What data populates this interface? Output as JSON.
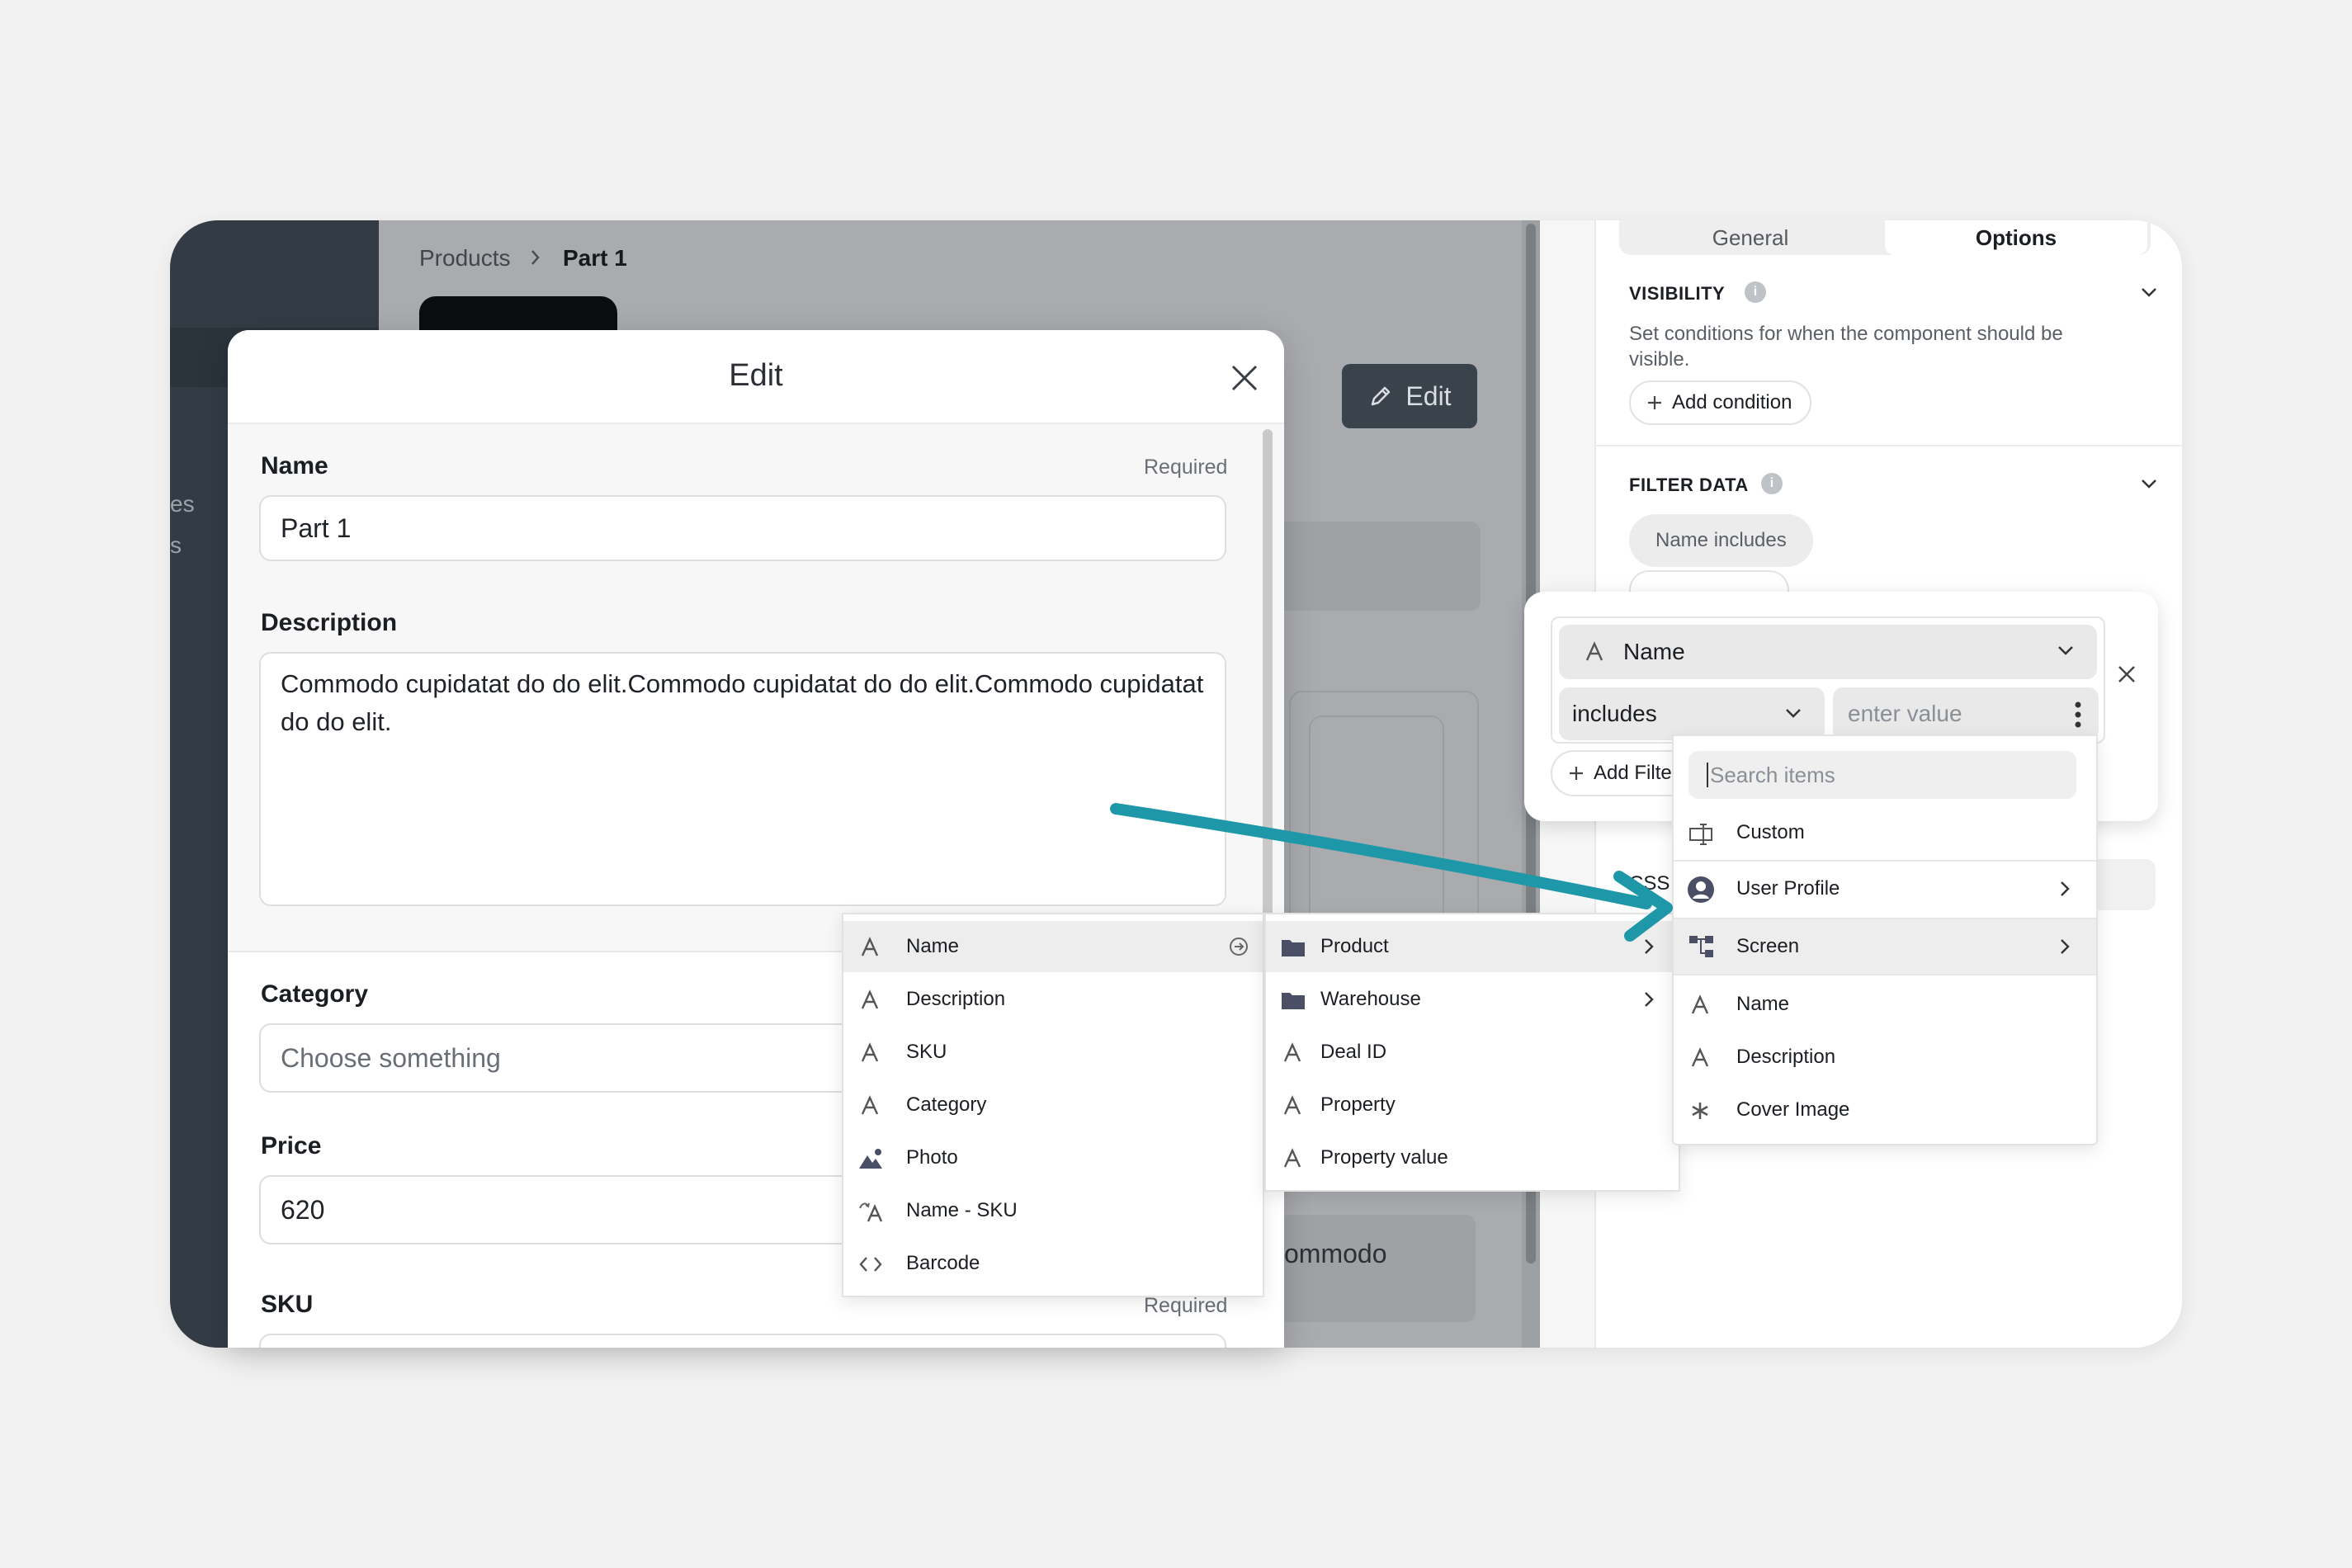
{
  "background": {
    "breadcrumb": [
      "Products",
      "Part 1"
    ],
    "edit_button": "Edit",
    "sidebar_fragments": [
      "es",
      "s"
    ],
    "ghost_text": "ommodo"
  },
  "right_panel": {
    "tabs": [
      "General",
      "Options"
    ],
    "visibility": {
      "title": "VISIBILITY",
      "description": "Set conditions for when the component should be visible.",
      "add_condition": "Add condition"
    },
    "filter_data": {
      "title": "FILTER DATA",
      "chip": "Name includes"
    },
    "css_label": "CSS"
  },
  "modal": {
    "title": "Edit",
    "fields": {
      "name": {
        "label": "Name",
        "required": "Required",
        "value": "Part 1"
      },
      "description": {
        "label": "Description",
        "value": "Commodo cupidatat do do elit.Commodo cupidatat do do elit.Commodo cupidatat do do elit."
      },
      "category": {
        "label": "Category",
        "placeholder": "Choose something"
      },
      "price": {
        "label": "Price",
        "value": "620"
      },
      "sku": {
        "label": "SKU",
        "required": "Required"
      }
    }
  },
  "filter_popover": {
    "field": "Name",
    "operator": "includes",
    "value_placeholder": "enter value",
    "add_filter": "Add Filter"
  },
  "field_menu": {
    "items": [
      {
        "label": "Name",
        "icon": "text-icon"
      },
      {
        "label": "Description",
        "icon": "text-icon"
      },
      {
        "label": "SKU",
        "icon": "text-icon"
      },
      {
        "label": "Category",
        "icon": "text-icon"
      },
      {
        "label": "Photo",
        "icon": "image-icon"
      },
      {
        "label": "Name - SKU",
        "icon": "formula-text-icon"
      },
      {
        "label": "Barcode",
        "icon": "code-icon"
      }
    ]
  },
  "relation_menu": {
    "items": [
      {
        "label": "Product",
        "icon": "folder-icon"
      },
      {
        "label": "Warehouse",
        "icon": "folder-icon"
      },
      {
        "label": "Deal ID",
        "icon": "text-icon"
      },
      {
        "label": "Property",
        "icon": "text-icon"
      },
      {
        "label": "Property value",
        "icon": "text-icon"
      }
    ]
  },
  "source_menu": {
    "search_placeholder": "Search items",
    "items": [
      {
        "label": "Custom",
        "icon": "custom-field-icon"
      },
      {
        "label": "User Profile",
        "icon": "user-circle-icon"
      },
      {
        "label": "Screen",
        "icon": "hierarchy-icon"
      },
      {
        "label": "Name",
        "icon": "text-icon"
      },
      {
        "label": "Description",
        "icon": "text-icon"
      },
      {
        "label": "Cover Image",
        "icon": "asterisk-icon"
      }
    ]
  },
  "colors": {
    "accent_arrow": "#1e97a8",
    "sidebar": "#333c45",
    "dark_button": "#3a424b",
    "highlight_row": "#ededed"
  }
}
